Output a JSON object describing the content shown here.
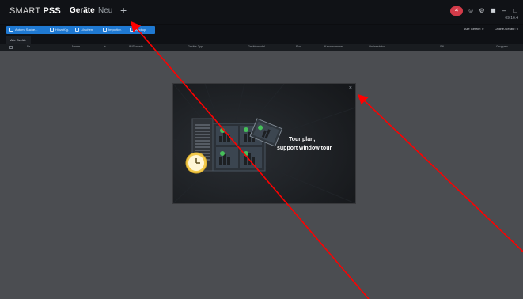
{
  "app": {
    "logo_prefix": "SMART ",
    "logo_bold": "PSS",
    "tabs": {
      "active": "Geräte",
      "new": "Neu",
      "add": "+"
    },
    "status_pill": "4",
    "clock": "09:16:4"
  },
  "toolbar": {
    "buttons": [
      {
        "label": "Autom. Suche..."
      },
      {
        "label": "Hinzufüg."
      },
      {
        "label": "Löschen"
      },
      {
        "label": "Importier."
      },
      {
        "label": "Backup"
      }
    ],
    "counts": {
      "all_label": "Alle Geräte:",
      "all_value": "0",
      "online_label": "Online-Geräte:",
      "online_value": "0"
    }
  },
  "subtabs": {
    "all_devices": "Alle Geräte"
  },
  "table": {
    "headers": [
      "Nr.",
      "Name",
      "▲",
      "IP/Domain",
      "Geräte-Typ",
      "Gerätemodel",
      "Port",
      "Kanalnummer",
      "Onlinestatus",
      "SN",
      "Gruppen"
    ]
  },
  "modal": {
    "line1": "Tour plan,",
    "line2": "support window tour",
    "close": "×"
  },
  "colors": {
    "accent": "#1f79d2",
    "titlebar": "#101216",
    "background": "#4b4d51",
    "modal": "#1d2023",
    "alert": "#d33b49",
    "arrow": "#ff0000"
  }
}
